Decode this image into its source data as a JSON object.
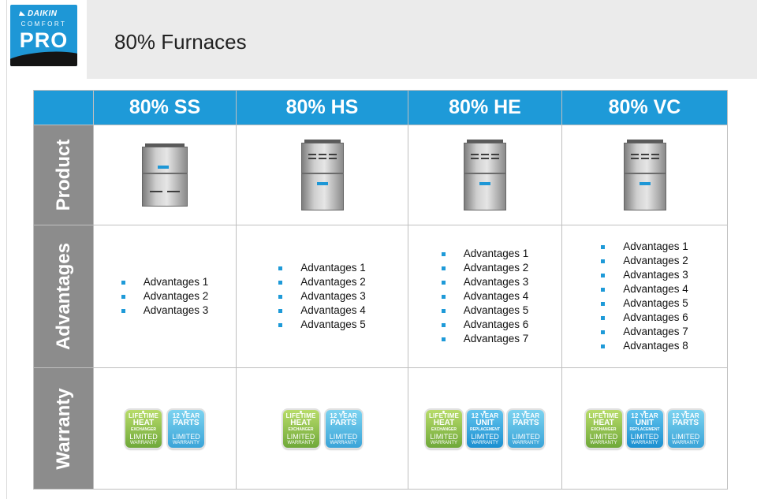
{
  "logo": {
    "brand": "DAIKIN",
    "sub": "COMFORT",
    "main": "PRO"
  },
  "page_title": "80% Furnaces",
  "columns": [
    "80% SS",
    "80% HS",
    "80% HE",
    "80% VC"
  ],
  "row_labels": {
    "product": "Product",
    "advantages": "Advantages",
    "warranty": "Warranty"
  },
  "advantages": {
    "ss": [
      "Advantages 1",
      "Advantages 2",
      "Advantages 3"
    ],
    "hs": [
      "Advantages 1",
      "Advantages 2",
      "Advantages 3",
      "Advantages 4",
      "Advantages 5"
    ],
    "he": [
      "Advantages 1",
      "Advantages 2",
      "Advantages 3",
      "Advantages 4",
      "Advantages 5",
      "Advantages 6",
      "Advantages 7"
    ],
    "vc": [
      "Advantages 1",
      "Advantages 2",
      "Advantages 3",
      "Advantages 4",
      "Advantages 5",
      "Advantages 6",
      "Advantages 7",
      "Advantages 8"
    ]
  },
  "warranty_badges": {
    "heat": {
      "l1": "LIFETIME",
      "l2": "HEAT",
      "l3": "EXCHANGER",
      "l4": "LIMITED",
      "l5": "WARRANTY"
    },
    "unit": {
      "l1": "12 YEAR",
      "l2": "UNIT",
      "l3": "REPLACEMENT",
      "l4": "LIMITED",
      "l5": "WARRANTY"
    },
    "parts": {
      "l1": "12 YEAR",
      "l2": "PARTS",
      "l3": "",
      "l4": "LIMITED",
      "l5": "WARRANTY"
    }
  },
  "colors": {
    "header_blue": "#1e9ad8",
    "side_gray": "#8c8c8c",
    "bullet": "#1e9ad8"
  }
}
